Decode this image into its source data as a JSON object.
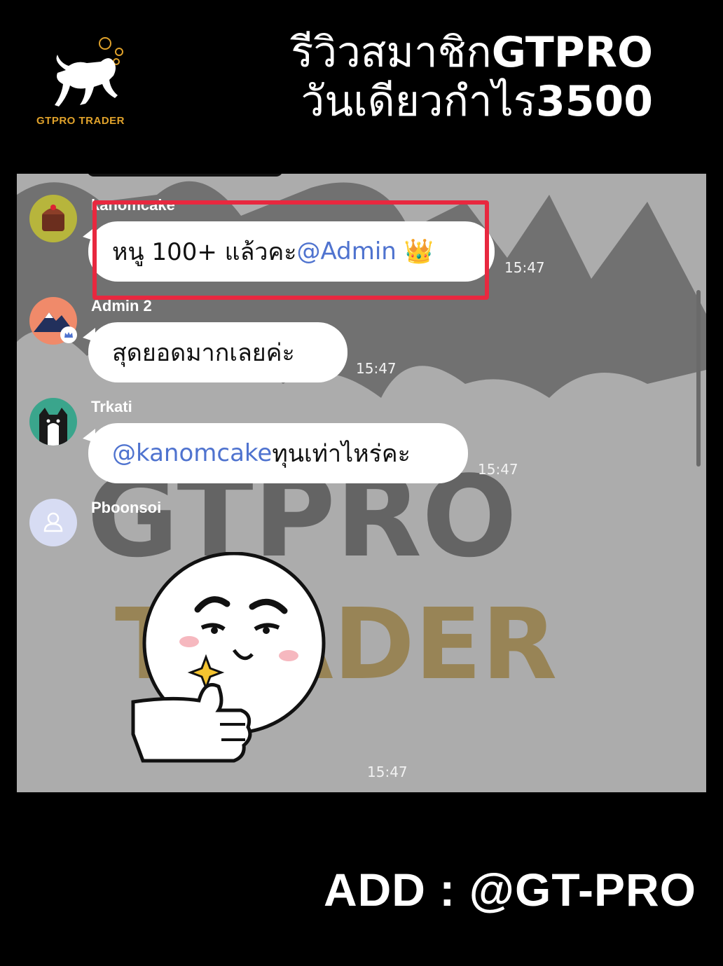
{
  "brand": {
    "logo_text": "GTPRO TRADER",
    "accent": "#e0a22b"
  },
  "headline": {
    "line1_thai": "รีวิวสมาชิก",
    "line1_latin": "GTPRO",
    "line2_thai": "วันเดียวกำไร",
    "line2_latin": "3500"
  },
  "chat": {
    "watermark": {
      "top": "GTPRO",
      "bottom": "TRADER"
    },
    "messages": [
      {
        "sender": "kanomcake",
        "avatar_icon": "cake-icon",
        "text": "หนู 100+ แล้วคะ ",
        "mention": "@Admin",
        "emoji": "👑",
        "time": "15:47",
        "highlighted": true
      },
      {
        "sender": "Admin 2",
        "avatar_icon": "mountain-icon",
        "text": "สุดยอดมากเลยค่ะ",
        "time": "15:47"
      },
      {
        "sender": "Trkati",
        "avatar_icon": "cat-icon",
        "mention": "@kanomcake",
        "text": " ทุนเท่าไหร่คะ",
        "time": "15:47"
      },
      {
        "sender": "Pboonsoi",
        "avatar_icon": "default-user-icon",
        "sticker": "thumbs-up-sticker",
        "time": "15:47"
      }
    ]
  },
  "footer": {
    "add_label": "ADD : @GT-PRO"
  }
}
